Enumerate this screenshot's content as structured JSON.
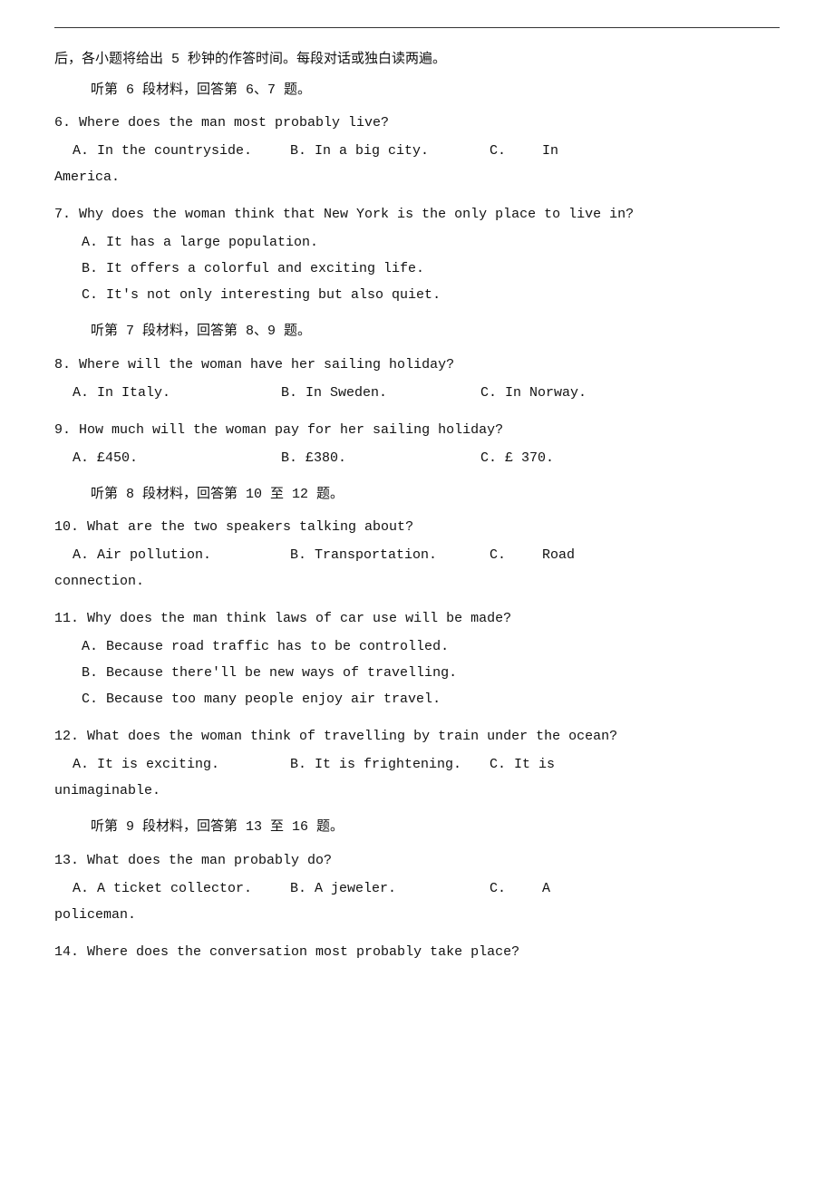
{
  "divider": true,
  "intro": "后，各小题将给出 5 秒钟的作答时间。每段对话或独白读两遍。",
  "sections": [
    {
      "header": "听第 6 段材料，回答第 6、7 题。",
      "questions": [
        {
          "number": "6",
          "text": "Where does the man most probably live?",
          "options_type": "row_with_continuation",
          "options": [
            "A. In the countryside.",
            "B. In a big city.",
            "C.",
            "In"
          ],
          "continuation": "America."
        },
        {
          "number": "7",
          "text": "Why does the woman think that New York is the only place to live in?",
          "options_type": "block",
          "options": [
            "A. It has a large population.",
            "B. It offers a colorful and exciting life.",
            "C. It's not only interesting but also quiet."
          ]
        }
      ]
    },
    {
      "header": "听第 7 段材料，回答第 8、9 题。",
      "questions": [
        {
          "number": "8",
          "text": "Where will the woman have her sailing holiday?",
          "options_type": "row",
          "options": [
            "A. In Italy.",
            "B. In Sweden.",
            "C. In Norway."
          ]
        },
        {
          "number": "9",
          "text": "How much will the woman pay for her sailing holiday?",
          "options_type": "row",
          "options": [
            "A. £450.",
            "B. £380.",
            "C. £ 370."
          ]
        }
      ]
    },
    {
      "header": "听第 8 段材料，回答第 10 至 12 题。",
      "questions": [
        {
          "number": "10",
          "text": "What are the two speakers talking about?",
          "options_type": "row_with_continuation",
          "options": [
            "A. Air pollution.",
            "B. Transportation.",
            "C.",
            "Road"
          ],
          "continuation": "connection."
        },
        {
          "number": "11",
          "text": "Why does the man think laws of car use will be made?",
          "options_type": "block",
          "options": [
            "A. Because road traffic has to be controlled.",
            "B. Because there'll be new ways of travelling.",
            "C. Because too many people enjoy air travel."
          ]
        },
        {
          "number": "12",
          "text": "What does the woman think of travelling by train under the ocean?",
          "options_type": "row_with_continuation",
          "options": [
            "A. It is exciting.",
            "B. It is frightening.",
            "C. It is"
          ],
          "continuation": "unimaginable."
        }
      ]
    },
    {
      "header": "听第 9 段材料，回答第 13 至 16 题。",
      "questions": [
        {
          "number": "13",
          "text": "What does the man probably do?",
          "options_type": "row_with_continuation",
          "options": [
            "A. A ticket collector.",
            "B. A jeweler.",
            "C.",
            "A"
          ],
          "continuation": "policeman."
        },
        {
          "number": "14",
          "text": "Where does the conversation most probably take place?"
        }
      ]
    }
  ]
}
